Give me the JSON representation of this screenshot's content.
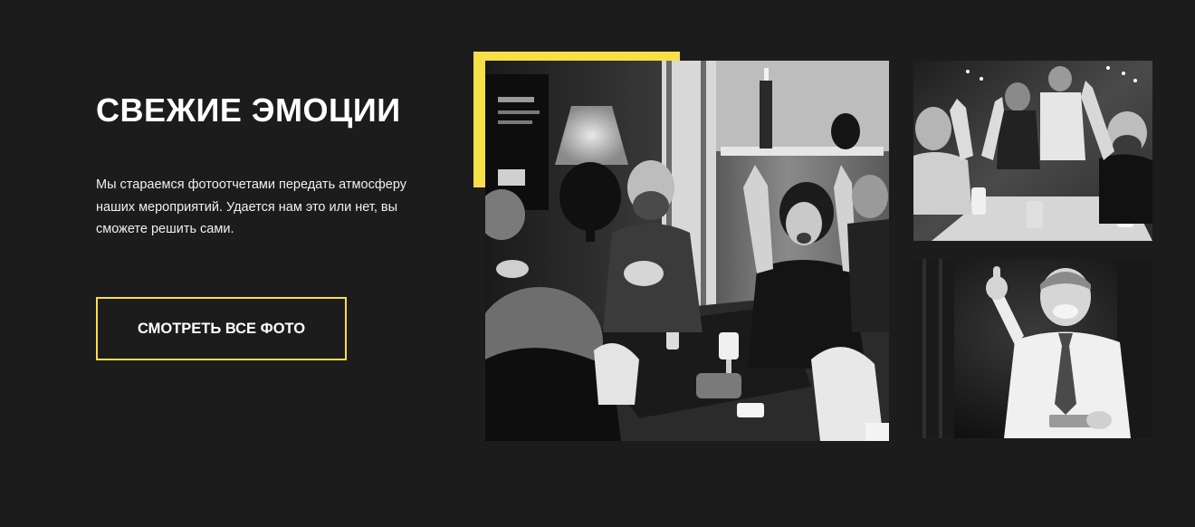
{
  "gallery": {
    "title": "СВЕЖИЕ ЭМОЦИИ",
    "description": "Мы стараемся фотоотчетами передать атмосферу наших мероприятий. Удается нам это или нет, вы сможете решить сами.",
    "button_label": "СМОТРЕТЬ ВСЕ ФОТО",
    "accent_color": "#f7df4a",
    "background_color": "#1c1c1c",
    "photos": [
      {
        "name": "party-table-photo",
        "tone": "black-and-white"
      },
      {
        "name": "cheering-men-photo",
        "tone": "black-and-white"
      },
      {
        "name": "man-thumbs-up-photo",
        "tone": "black-and-white"
      }
    ]
  }
}
